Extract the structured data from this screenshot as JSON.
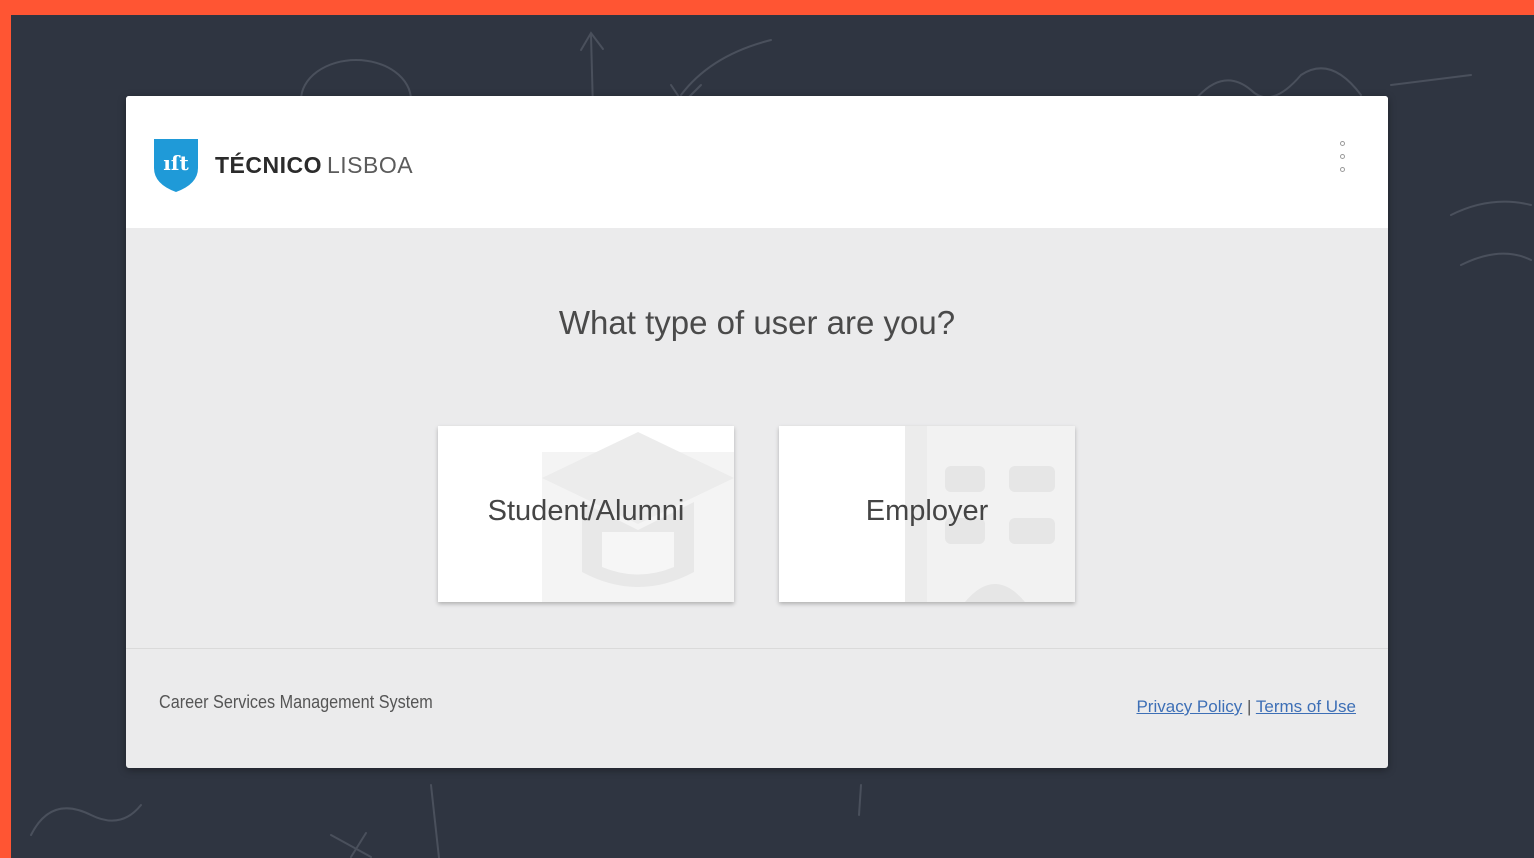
{
  "header": {
    "brand_bold": "TÉCNICO",
    "brand_light": "LISBOA",
    "logo_mark": "ıſt",
    "logo_icon": "ist-shield-icon",
    "menu_icon": "vertical-dots-icon"
  },
  "main": {
    "question": "What type of user are you?",
    "options": [
      {
        "label": "Student/Alumni",
        "icon": "graduation-cap-icon"
      },
      {
        "label": "Employer",
        "icon": "building-icon"
      }
    ]
  },
  "footer": {
    "system_name": "Career Services Management System",
    "privacy_label": "Privacy Policy",
    "separator": "|",
    "terms_label": "Terms of Use"
  },
  "colors": {
    "outer_border": "#ff5533",
    "background": "#2f3541",
    "brand_blue": "#1f9ad8",
    "link": "#3d6fb6"
  }
}
